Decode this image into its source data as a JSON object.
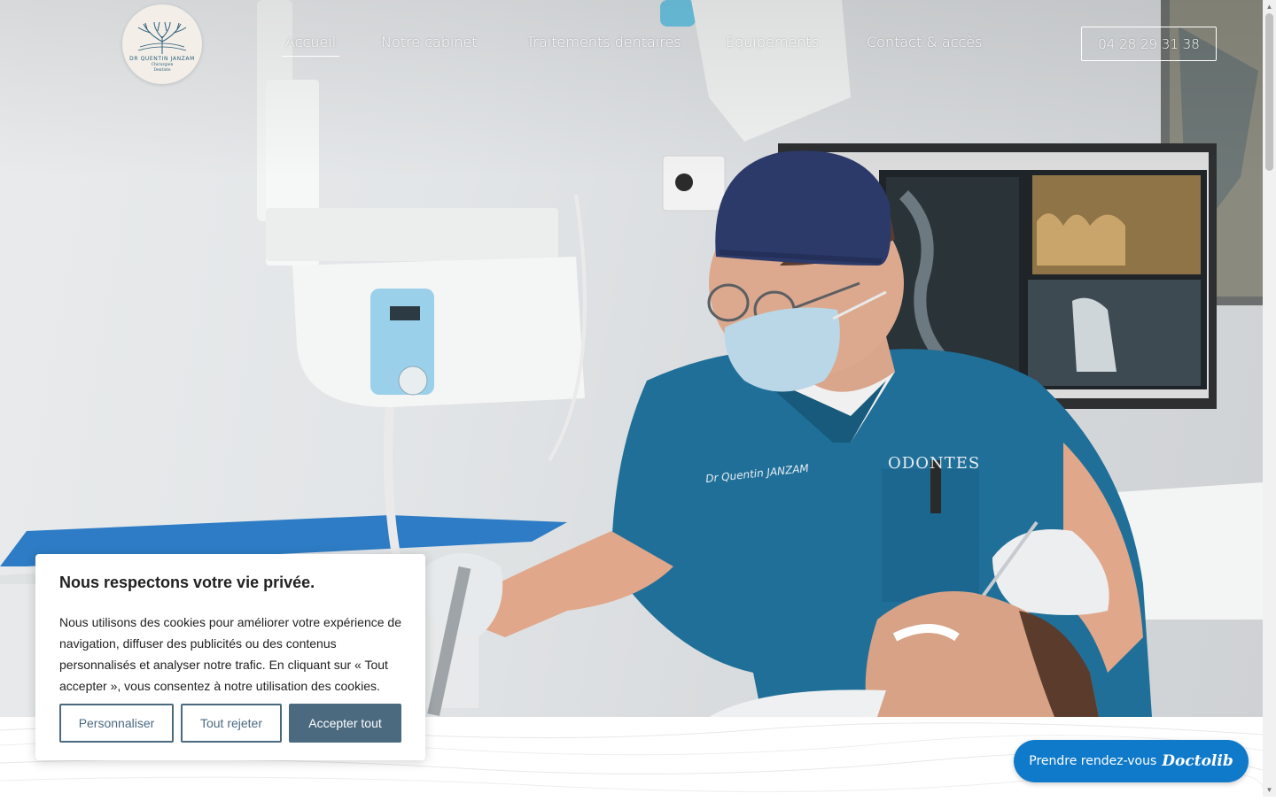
{
  "header": {
    "logo": {
      "name": "DR QUENTIN JANZAM",
      "subtitle_line1": "Chirurgien",
      "subtitle_line2": "Dentiste"
    },
    "nav": [
      {
        "label": "Accueil",
        "active": true
      },
      {
        "label": "Notre cabinet",
        "active": false
      },
      {
        "label": "Traitements dentaires",
        "active": false
      },
      {
        "label": "Equipements",
        "active": false
      },
      {
        "label": "Contact & accès",
        "active": false
      }
    ],
    "phone": "04 28 29 31 38"
  },
  "hero": {
    "scrub_name": "Dr Quentin JANZAM",
    "scrub_brand": "ODONTES"
  },
  "cookie_banner": {
    "title": "Nous respectons votre vie privée.",
    "text": "Nous utilisons des cookies pour améliorer votre expérience de navigation, diffuser des publicités ou des contenus personnalisés et analyser notre trafic. En cliquant sur « Tout accepter », vous consentez à notre utilisation des cookies.",
    "buttons": {
      "customize": "Personnaliser",
      "reject": "Tout rejeter",
      "accept": "Accepter tout"
    }
  },
  "booking": {
    "label": "Prendre rendez-vous",
    "brand": "Doctolib"
  },
  "colors": {
    "accent_button": "#4b6a80",
    "doctolib_blue": "#107aca",
    "logo_blue": "#2a5d7a",
    "scrubs_blue": "#1f6f98"
  }
}
